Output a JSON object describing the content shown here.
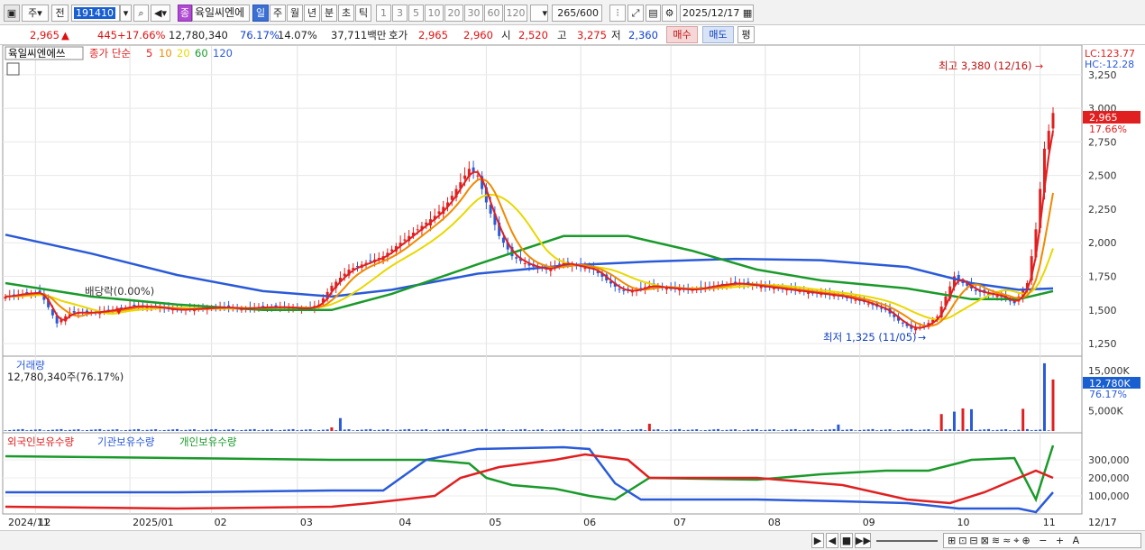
{
  "toolbar": {
    "market": "주",
    "prev": "전",
    "code": "191410",
    "stock_badge": "종",
    "stock_name": "육일씨엔에",
    "periods": [
      "일",
      "주",
      "월",
      "년",
      "분",
      "초",
      "틱"
    ],
    "active_period": "일",
    "intervals": [
      "1",
      "3",
      "5",
      "10",
      "20",
      "30",
      "60",
      "120"
    ],
    "count_value": "265",
    "count_max": "/600",
    "date_value": "2025/12/17"
  },
  "info": {
    "price": "2,965",
    "change": "445",
    "change_pct": "+17.66%",
    "volume": "12,780,340",
    "vol_ratio": "76.17%",
    "turnover": "14.07%",
    "amount": "37,711백만",
    "quote_label": "호가",
    "ask": "2,965",
    "bid": "2,960",
    "open_label": "시",
    "open": "2,520",
    "high_label": "고",
    "high": "3,275",
    "low_label": "저",
    "low": "2,360",
    "buy_btn": "매수",
    "sell_btn": "매도",
    "eval_btn": "평"
  },
  "chart_data": {
    "type": "candlestick",
    "price_legend": {
      "name": "육일씨엔에쓰",
      "series_label": "종가 단순",
      "ma_periods": [
        "5",
        "10",
        "20",
        "60",
        "120"
      ],
      "ma_colors": [
        "#e02020",
        "#f08a00",
        "#e8d800",
        "#1a9a2a",
        "#2a5ad8"
      ]
    },
    "lc": "LC:123.77",
    "hc": "HC:-12.28",
    "max_label": "최고 3,380 (12/16)",
    "min_label": "최저 1,325 (11/05)",
    "dividend_label": "배당락(0.00%)",
    "last_price_tag": "2,965",
    "last_pct_tag": "17.66%",
    "y_ticks": [
      "3,250",
      "3,000",
      "2,750",
      "2,500",
      "2,250",
      "2,000",
      "1,750",
      "1,500",
      "1,250"
    ],
    "y_tick_values": [
      3250,
      3000,
      2750,
      2500,
      2250,
      2000,
      1750,
      1500,
      1250
    ],
    "ylim": [
      1190,
      3430
    ],
    "x_ticks": [
      "2024/11",
      "12",
      "2025/01",
      "02",
      "03",
      "04",
      "05",
      "06",
      "07",
      "08",
      "09",
      "10",
      "11",
      "12",
      "12/17"
    ],
    "price_path": [
      [
        0,
        1600
      ],
      [
        4,
        1620
      ],
      [
        8,
        1630
      ],
      [
        10,
        1520
      ],
      [
        12,
        1400
      ],
      [
        15,
        1480
      ],
      [
        20,
        1480
      ],
      [
        25,
        1500
      ],
      [
        30,
        1530
      ],
      [
        35,
        1520
      ],
      [
        40,
        1500
      ],
      [
        45,
        1510
      ],
      [
        50,
        1520
      ],
      [
        55,
        1510
      ],
      [
        60,
        1520
      ],
      [
        65,
        1520
      ],
      [
        70,
        1510
      ],
      [
        73,
        1540
      ],
      [
        76,
        1680
      ],
      [
        80,
        1800
      ],
      [
        84,
        1850
      ],
      [
        88,
        1900
      ],
      [
        92,
        2000
      ],
      [
        96,
        2100
      ],
      [
        100,
        2200
      ],
      [
        103,
        2300
      ],
      [
        106,
        2450
      ],
      [
        108,
        2550
      ],
      [
        110,
        2500
      ],
      [
        112,
        2300
      ],
      [
        115,
        2050
      ],
      [
        118,
        1900
      ],
      [
        122,
        1830
      ],
      [
        126,
        1800
      ],
      [
        130,
        1850
      ],
      [
        134,
        1820
      ],
      [
        137,
        1800
      ],
      [
        140,
        1720
      ],
      [
        143,
        1650
      ],
      [
        146,
        1640
      ],
      [
        150,
        1680
      ],
      [
        155,
        1660
      ],
      [
        160,
        1650
      ],
      [
        165,
        1680
      ],
      [
        170,
        1700
      ],
      [
        175,
        1680
      ],
      [
        180,
        1660
      ],
      [
        185,
        1640
      ],
      [
        190,
        1620
      ],
      [
        195,
        1600
      ],
      [
        200,
        1560
      ],
      [
        205,
        1500
      ],
      [
        208,
        1420
      ],
      [
        211,
        1360
      ],
      [
        214,
        1380
      ],
      [
        217,
        1450
      ],
      [
        219,
        1600
      ],
      [
        221,
        1750
      ],
      [
        223,
        1700
      ],
      [
        226,
        1640
      ],
      [
        229,
        1620
      ],
      [
        232,
        1600
      ],
      [
        235,
        1550
      ],
      [
        238,
        1700
      ],
      [
        240,
        2100
      ],
      [
        242,
        2700
      ],
      [
        244,
        2965
      ]
    ],
    "ma120_path": [
      [
        0,
        2060
      ],
      [
        20,
        1920
      ],
      [
        40,
        1760
      ],
      [
        60,
        1640
      ],
      [
        76,
        1600
      ],
      [
        90,
        1650
      ],
      [
        110,
        1770
      ],
      [
        130,
        1830
      ],
      [
        150,
        1860
      ],
      [
        170,
        1880
      ],
      [
        190,
        1870
      ],
      [
        210,
        1820
      ],
      [
        225,
        1700
      ],
      [
        236,
        1650
      ],
      [
        244,
        1660
      ]
    ],
    "ma60_path": [
      [
        0,
        1700
      ],
      [
        20,
        1600
      ],
      [
        40,
        1540
      ],
      [
        60,
        1500
      ],
      [
        76,
        1500
      ],
      [
        90,
        1620
      ],
      [
        110,
        1840
      ],
      [
        130,
        2050
      ],
      [
        145,
        2050
      ],
      [
        160,
        1940
      ],
      [
        175,
        1800
      ],
      [
        190,
        1720
      ],
      [
        210,
        1660
      ],
      [
        225,
        1580
      ],
      [
        236,
        1580
      ],
      [
        244,
        1640
      ]
    ],
    "volume": {
      "title": "거래량",
      "value_label": "12,780,340주(76.17%)",
      "y_ticks": [
        "15,000K",
        "5,000K"
      ],
      "y_tick_values": [
        15000,
        5000
      ],
      "ymax": 17000,
      "tag": "12,780K",
      "tag_pct": "76.17%",
      "bars": [
        [
          76,
          900
        ],
        [
          78,
          3200
        ],
        [
          150,
          1800
        ],
        [
          194,
          1600
        ],
        [
          218,
          4200
        ],
        [
          221,
          4800
        ],
        [
          223,
          5600
        ],
        [
          225,
          5400
        ],
        [
          237,
          5500
        ],
        [
          242,
          16800
        ],
        [
          244,
          12780
        ]
      ]
    },
    "holdings": {
      "legend": [
        "외국인보유수량",
        "기관보유수량",
        "개인보유수량"
      ],
      "colors": [
        "#e02020",
        "#2a5ad8",
        "#1a9a2a"
      ],
      "y_ticks": [
        "300,000",
        "200,000",
        "100,000"
      ],
      "y_tick_values": [
        300000,
        200000,
        100000
      ],
      "ylim": [
        0,
        400000
      ],
      "foreign": [
        [
          0,
          40000
        ],
        [
          40,
          30000
        ],
        [
          76,
          40000
        ],
        [
          85,
          60000
        ],
        [
          100,
          100000
        ],
        [
          106,
          200000
        ],
        [
          115,
          260000
        ],
        [
          128,
          300000
        ],
        [
          135,
          330000
        ],
        [
          145,
          300000
        ],
        [
          150,
          200000
        ],
        [
          175,
          200000
        ],
        [
          195,
          160000
        ],
        [
          210,
          80000
        ],
        [
          220,
          60000
        ],
        [
          228,
          120000
        ],
        [
          236,
          200000
        ],
        [
          240,
          240000
        ],
        [
          244,
          200000
        ]
      ],
      "institution": [
        [
          0,
          120000
        ],
        [
          40,
          120000
        ],
        [
          76,
          130000
        ],
        [
          88,
          130000
        ],
        [
          98,
          300000
        ],
        [
          110,
          360000
        ],
        [
          130,
          370000
        ],
        [
          136,
          360000
        ],
        [
          142,
          170000
        ],
        [
          148,
          80000
        ],
        [
          175,
          80000
        ],
        [
          195,
          70000
        ],
        [
          210,
          60000
        ],
        [
          222,
          30000
        ],
        [
          236,
          30000
        ],
        [
          240,
          10000
        ],
        [
          244,
          120000
        ]
      ],
      "individual": [
        [
          0,
          320000
        ],
        [
          40,
          310000
        ],
        [
          76,
          300000
        ],
        [
          98,
          300000
        ],
        [
          108,
          280000
        ],
        [
          112,
          200000
        ],
        [
          118,
          160000
        ],
        [
          128,
          140000
        ],
        [
          136,
          100000
        ],
        [
          142,
          80000
        ],
        [
          150,
          200000
        ],
        [
          175,
          190000
        ],
        [
          190,
          220000
        ],
        [
          205,
          240000
        ],
        [
          215,
          240000
        ],
        [
          225,
          300000
        ],
        [
          235,
          310000
        ],
        [
          240,
          80000
        ],
        [
          244,
          380000
        ]
      ]
    }
  }
}
